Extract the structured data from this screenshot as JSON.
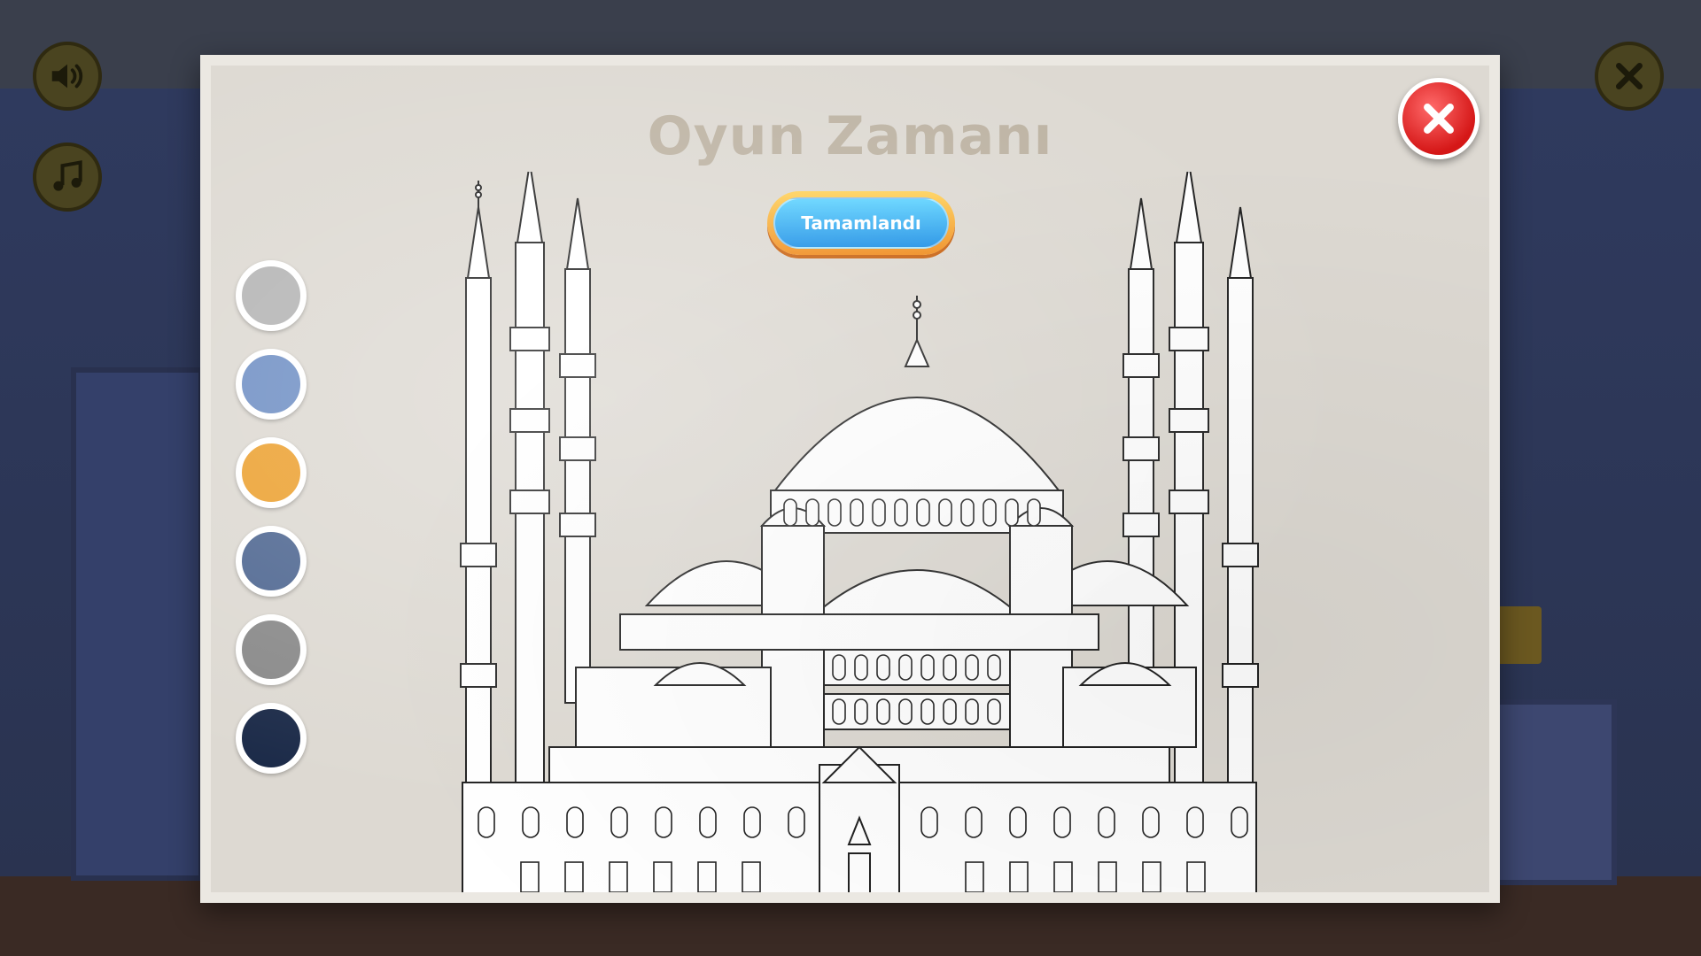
{
  "game": {
    "title": "Oyun Zamanı",
    "done_label": "Tamamlandı"
  },
  "icons": {
    "sound": "speaker-icon",
    "music": "music-note-icon",
    "exit": "x-icon",
    "close": "close-icon",
    "brush": "paintbrush-icon",
    "drawing": "mosque-outline"
  },
  "palette": {
    "colors": [
      "#b4b4b4",
      "#6f8fc4",
      "#eca131",
      "#4f6791",
      "#898989",
      "#1b2a48"
    ]
  },
  "colors": {
    "paper": "#ddd9d2",
    "title": "#bdb3a3",
    "done_button": "#1b8fe6",
    "done_border": "#f08a1a",
    "close_button": "#d51717"
  }
}
